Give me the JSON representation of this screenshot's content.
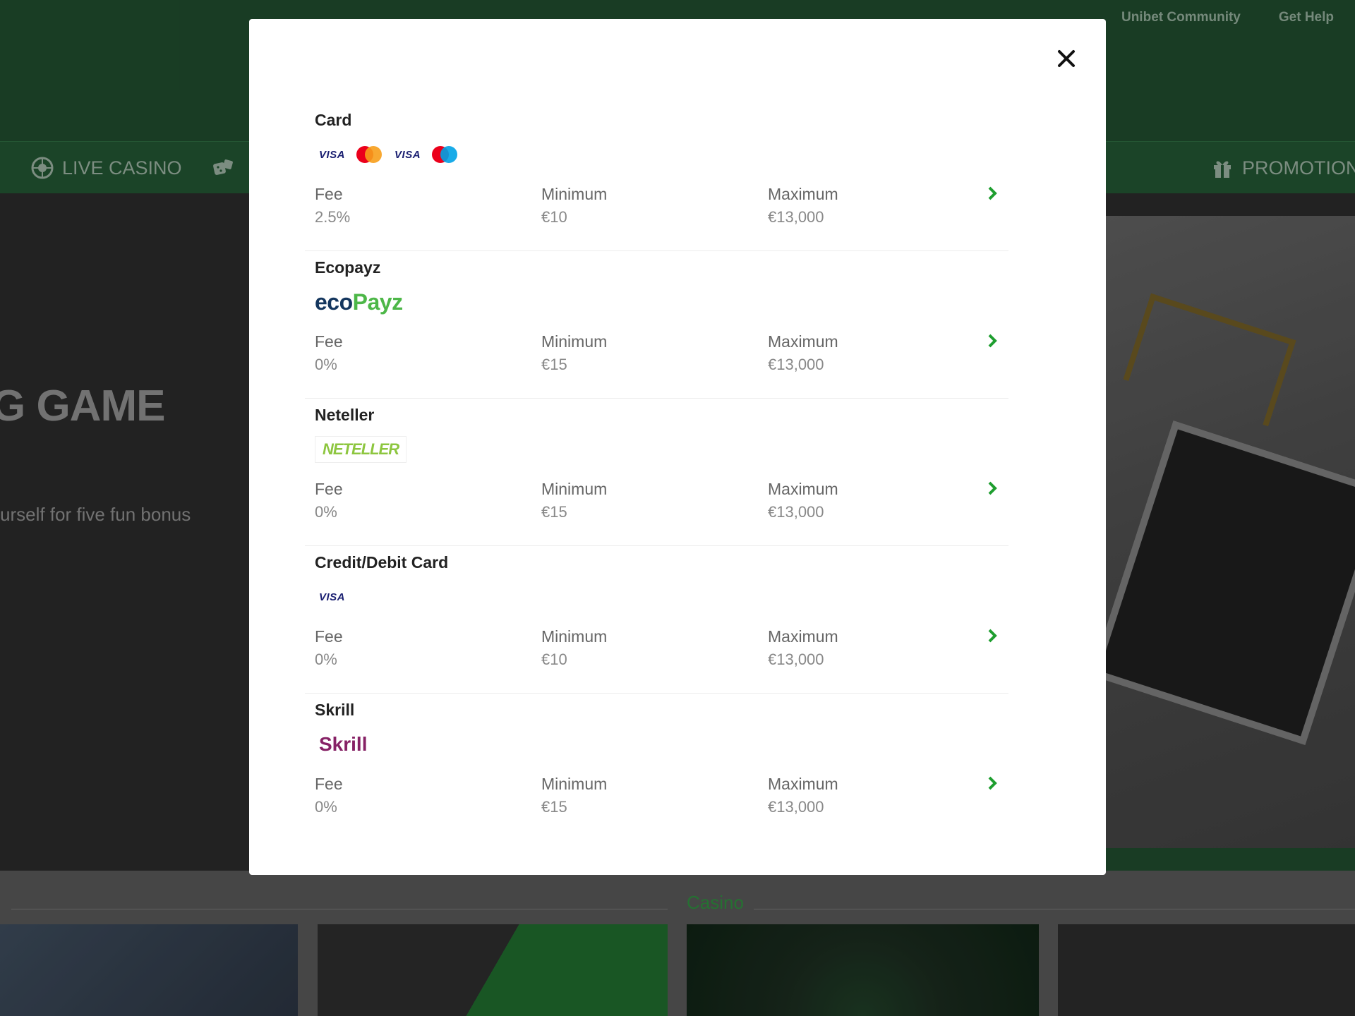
{
  "header": {
    "links": [
      "Unibet Community",
      "Get Help"
    ]
  },
  "nav": {
    "live_casino": "LIVE CASINO",
    "promotions": "PROMOTIONS"
  },
  "hero": {
    "title": "G GAME",
    "subtitle": "urself for five fun bonus"
  },
  "sections": {
    "casino": "Casino"
  },
  "modal": {
    "close_icon": "close-icon",
    "columns": {
      "fee": "Fee",
      "minimum": "Minimum",
      "maximum": "Maximum"
    },
    "methods": [
      {
        "name": "Card",
        "logos": [
          "VISA",
          "mastercard",
          "VISA",
          "maestro"
        ],
        "fee": "2.5%",
        "minimum": "€10",
        "maximum": "€13,000"
      },
      {
        "name": "Ecopayz",
        "logos": [
          "ecoPayz"
        ],
        "fee": "0%",
        "minimum": "€15",
        "maximum": "€13,000"
      },
      {
        "name": "Neteller",
        "logos": [
          "NETELLER"
        ],
        "fee": "0%",
        "minimum": "€15",
        "maximum": "€13,000"
      },
      {
        "name": "Credit/Debit Card",
        "logos": [
          "VISA"
        ],
        "fee": "0%",
        "minimum": "€10",
        "maximum": "€13,000"
      },
      {
        "name": "Skrill",
        "logos": [
          "Skrill"
        ],
        "fee": "0%",
        "minimum": "€15",
        "maximum": "€13,000"
      }
    ]
  },
  "colors": {
    "brand_green": "#1f4a2c",
    "accent_green": "#1e9e2f",
    "visa_blue": "#1a1f71",
    "skrill_purple": "#862165"
  }
}
